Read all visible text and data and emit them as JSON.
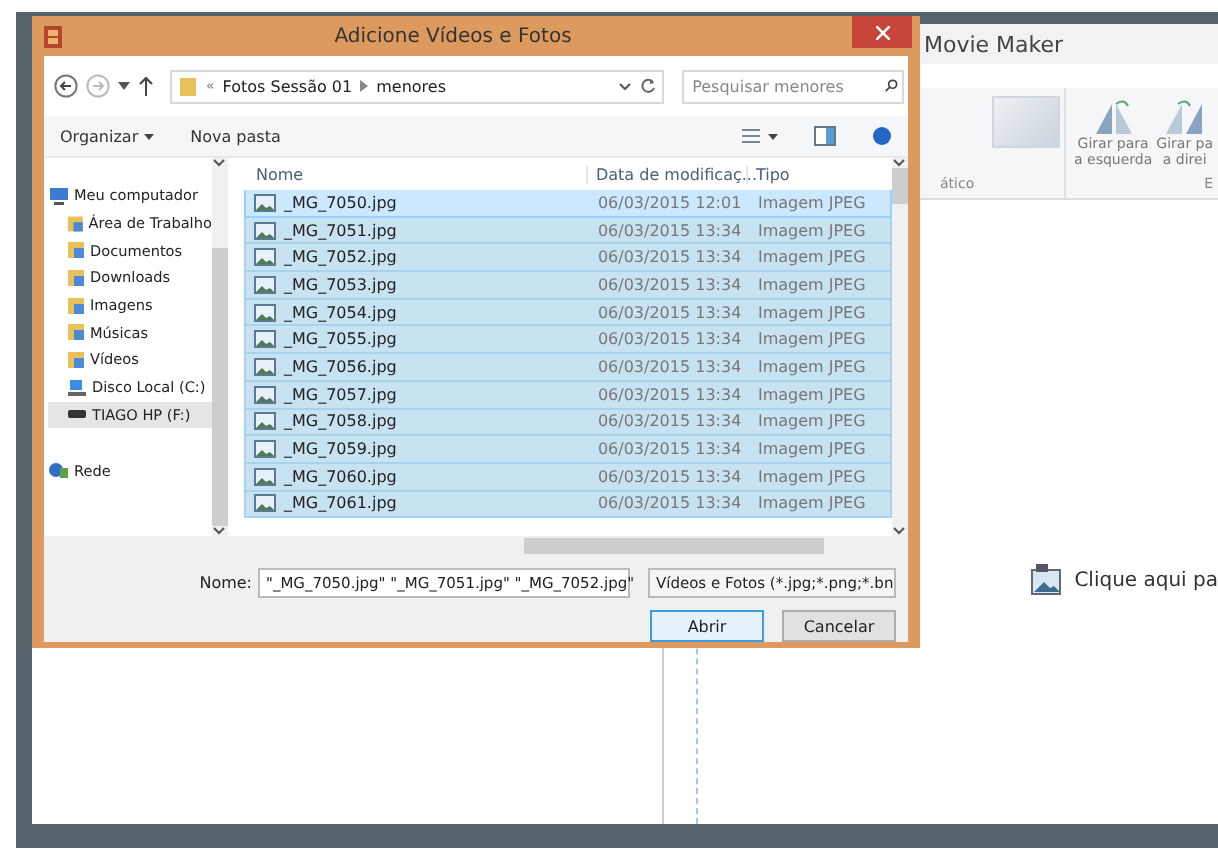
{
  "movie_maker": {
    "title": "Movie Maker",
    "ribbon": {
      "groups": [
        {
          "label": "ático"
        },
        {
          "label": "E"
        }
      ],
      "buttons": [
        {
          "kind": "rotate-left",
          "lines": [
            "Girar para",
            "a esquerda"
          ]
        },
        {
          "kind": "rotate-right",
          "lines": [
            "Girar pa",
            "a direi"
          ]
        }
      ]
    },
    "storyboard_hint": "Clique aqui pa"
  },
  "dialog": {
    "title": "Adicione Vídeos e Fotos",
    "overflow": "«",
    "breadcrumb": [
      "Fotos Sessão 01",
      "menores"
    ],
    "search": {
      "placeholder": "Pesquisar menores"
    },
    "toolbar": [
      {
        "label": "Organizar",
        "menu": true
      },
      {
        "label": "Nova pasta",
        "menu": false
      }
    ],
    "nav": [
      {
        "label": "Meu computador",
        "kind": "computer",
        "expanded": true,
        "selected": false,
        "children": [
          {
            "label": "Área de Trabalho",
            "kind": "folder",
            "selected": false
          },
          {
            "label": "Documentos",
            "kind": "folder",
            "selected": false
          },
          {
            "label": "Downloads",
            "kind": "folder",
            "selected": false
          },
          {
            "label": "Imagens",
            "kind": "folder",
            "selected": false
          },
          {
            "label": "Músicas",
            "kind": "folder",
            "selected": false
          },
          {
            "label": "Vídeos",
            "kind": "folder",
            "selected": false
          },
          {
            "label": "Disco Local (C:)",
            "kind": "disk",
            "selected": false
          },
          {
            "label": "TIAGO HP (F:)",
            "kind": "drive",
            "selected": true
          }
        ]
      },
      {
        "label": "Rede",
        "kind": "network",
        "expanded": false,
        "selected": false
      }
    ],
    "columns": [
      "Nome",
      "Data de modificaç...",
      "Tipo"
    ],
    "rows": [
      {
        "name": "_MG_7050.jpg",
        "date": "06/03/2015 12:01",
        "type": "Imagem JPEG",
        "selected": true,
        "focused": true
      },
      {
        "name": "_MG_7051.jpg",
        "date": "06/03/2015 13:34",
        "type": "Imagem JPEG",
        "selected": true,
        "focused": false
      },
      {
        "name": "_MG_7052.jpg",
        "date": "06/03/2015 13:34",
        "type": "Imagem JPEG",
        "selected": true,
        "focused": false
      },
      {
        "name": "_MG_7053.jpg",
        "date": "06/03/2015 13:34",
        "type": "Imagem JPEG",
        "selected": true,
        "focused": false
      },
      {
        "name": "_MG_7054.jpg",
        "date": "06/03/2015 13:34",
        "type": "Imagem JPEG",
        "selected": true,
        "focused": false
      },
      {
        "name": "_MG_7055.jpg",
        "date": "06/03/2015 13:34",
        "type": "Imagem JPEG",
        "selected": true,
        "focused": false
      },
      {
        "name": "_MG_7056.jpg",
        "date": "06/03/2015 13:34",
        "type": "Imagem JPEG",
        "selected": true,
        "focused": false
      },
      {
        "name": "_MG_7057.jpg",
        "date": "06/03/2015 13:34",
        "type": "Imagem JPEG",
        "selected": true,
        "focused": false
      },
      {
        "name": "_MG_7058.jpg",
        "date": "06/03/2015 13:34",
        "type": "Imagem JPEG",
        "selected": true,
        "focused": false
      },
      {
        "name": "_MG_7059.jpg",
        "date": "06/03/2015 13:34",
        "type": "Imagem JPEG",
        "selected": true,
        "focused": false
      },
      {
        "name": "_MG_7060.jpg",
        "date": "06/03/2015 13:34",
        "type": "Imagem JPEG",
        "selected": true,
        "focused": false
      },
      {
        "name": "_MG_7061.jpg",
        "date": "06/03/2015 13:34",
        "type": "Imagem JPEG",
        "selected": true,
        "focused": false
      }
    ],
    "file_name": {
      "label": "Nome:",
      "value": "\"_MG_7050.jpg\" \"_MG_7051.jpg\" \"_MG_7052.jpg\""
    },
    "filter": "Vídeos e Fotos (*.jpg;*.png;*.bn",
    "buttons": [
      {
        "label": "Abrir",
        "default": true
      },
      {
        "label": "Cancelar",
        "default": false
      }
    ]
  }
}
